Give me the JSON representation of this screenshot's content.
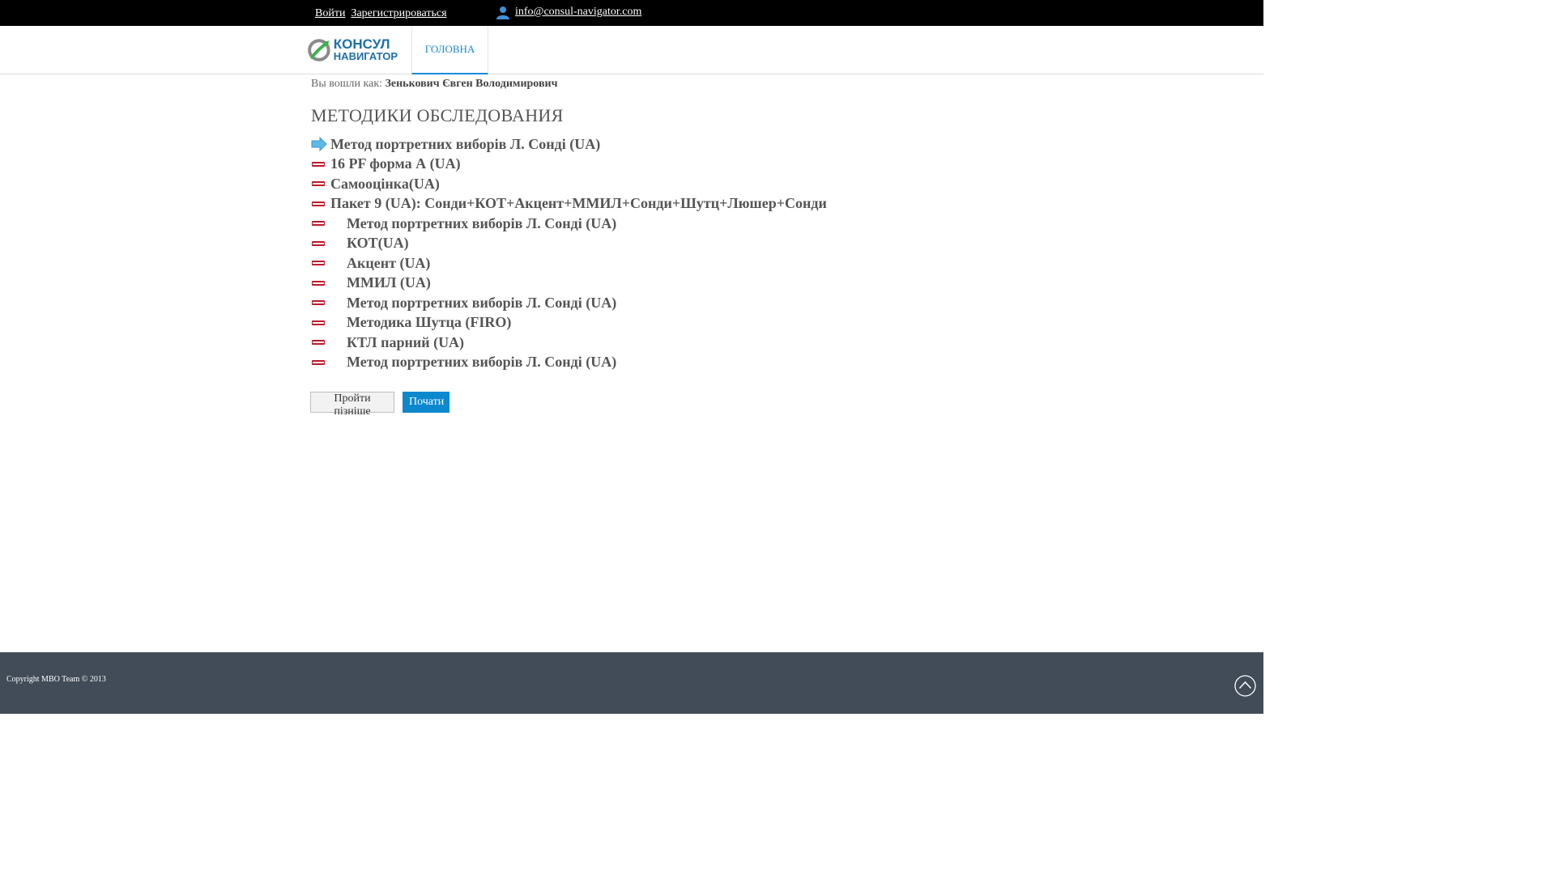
{
  "topbar": {
    "login_label": "Войти",
    "register_label": "Зарегистрироваться",
    "email": "info@consul-navigator.com"
  },
  "header": {
    "logo": {
      "line1": "КОНСУЛ",
      "line2": "НАВИГАТОР"
    },
    "nav": [
      {
        "label": "ГОЛОВНА",
        "active": true
      }
    ]
  },
  "user": {
    "prefix": "Вы вошли как:",
    "name": "Зенькович Євген Володимирович"
  },
  "main": {
    "title": "МЕТОДИКИ ОБСЛЕДОВАНИЯ",
    "tests": [
      {
        "label": "Метод портретних виборів Л. Сонді (UA)",
        "current": true,
        "indent": false
      },
      {
        "label": "16 PF форма А (UA)",
        "current": false,
        "indent": false
      },
      {
        "label": "Самооцінка(UA)",
        "current": false,
        "indent": false
      },
      {
        "label": "Пакет 9 (UA): Сонди+КОТ+Акцент+ММИЛ+Сонди+Шутц+Люшер+Сонди",
        "current": false,
        "indent": false
      },
      {
        "label": "Метод портретних виборів Л. Сонді (UA)",
        "current": false,
        "indent": true
      },
      {
        "label": "КОТ(UA)",
        "current": false,
        "indent": true
      },
      {
        "label": "Акцент (UA)",
        "current": false,
        "indent": true
      },
      {
        "label": "ММИЛ (UA)",
        "current": false,
        "indent": true
      },
      {
        "label": "Метод портретних виборів Л. Сонді (UA)",
        "current": false,
        "indent": true
      },
      {
        "label": "Методика Шутца (FIRO)",
        "current": false,
        "indent": true
      },
      {
        "label": "КТЛ парний (UA)",
        "current": false,
        "indent": true
      },
      {
        "label": "Метод портретних виборів Л. Сонді (UA)",
        "current": false,
        "indent": true
      }
    ],
    "buttons": {
      "later": "Пройти пізніше",
      "start": "Почати"
    }
  },
  "footer": {
    "copyright": "Copyright MBO Team © 2013"
  },
  "icons": {
    "current_item": "arrow-right-icon",
    "item": "dash-marker-icon",
    "user": "user-icon",
    "scroll_top": "chevron-up-circle-icon"
  },
  "colors": {
    "topbar_bg": "#000000",
    "accent": "#1a8ad4",
    "start_button": "#0c88cf",
    "marker_red": "#c0182a",
    "footer_bg": "#414c58"
  }
}
